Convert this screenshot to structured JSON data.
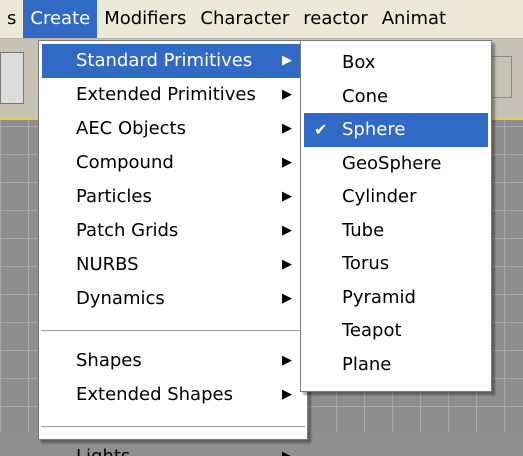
{
  "menubar": {
    "items": [
      "s",
      "Create",
      "Modifiers",
      "Character",
      "reactor",
      "Animat"
    ]
  },
  "create_menu": {
    "items": [
      {
        "label": "Standard Primitives",
        "submenu": true
      },
      {
        "label": "Extended Primitives",
        "submenu": true
      },
      {
        "label": "AEC Objects",
        "submenu": true
      },
      {
        "label": "Compound",
        "submenu": true
      },
      {
        "label": "Particles",
        "submenu": true
      },
      {
        "label": "Patch Grids",
        "submenu": true
      },
      {
        "label": "NURBS",
        "submenu": true
      },
      {
        "label": "Dynamics",
        "submenu": true
      },
      {
        "label": "Shapes",
        "submenu": true
      },
      {
        "label": "Extended Shapes",
        "submenu": true
      },
      {
        "label": "Lights",
        "submenu": true
      }
    ]
  },
  "primitives_menu": {
    "items": [
      "Box",
      "Cone",
      "Sphere",
      "GeoSphere",
      "Cylinder",
      "Tube",
      "Torus",
      "Pyramid",
      "Teapot",
      "Plane"
    ],
    "checked": "Sphere"
  },
  "icons": {
    "submenu_arrow": "▶",
    "check": "✔"
  },
  "colors": {
    "highlight": "#316ac5",
    "menubar": "#ece9d8"
  }
}
